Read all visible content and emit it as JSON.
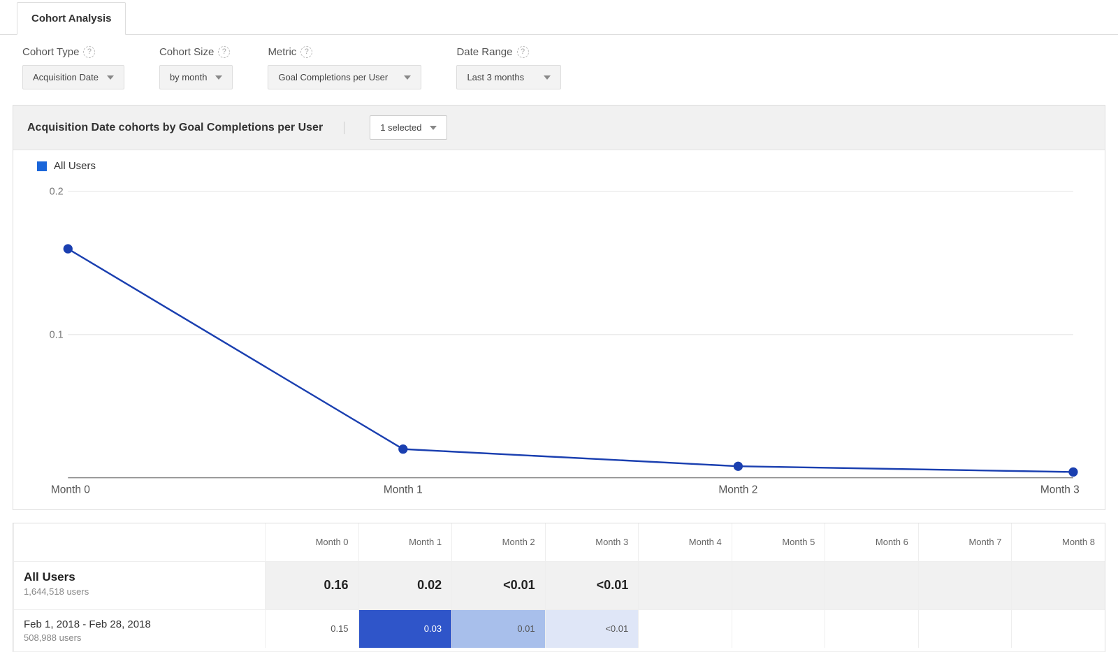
{
  "tab": {
    "label": "Cohort Analysis"
  },
  "filters": {
    "cohortType": {
      "label": "Cohort Type",
      "value": "Acquisition Date"
    },
    "cohortSize": {
      "label": "Cohort Size",
      "value": "by month"
    },
    "metric": {
      "label": "Metric",
      "value": "Goal Completions per User"
    },
    "dateRange": {
      "label": "Date Range",
      "value": "Last 3 months"
    }
  },
  "panel": {
    "title": "Acquisition Date cohorts by Goal Completions per User",
    "selected": "1 selected"
  },
  "legend": {
    "series1": "All Users"
  },
  "chart_data": {
    "type": "line",
    "title": "Acquisition Date cohorts by Goal Completions per User",
    "xlabel": "",
    "ylabel": "",
    "ylim": [
      0,
      0.2
    ],
    "y_ticks": [
      0.1,
      0.2
    ],
    "categories": [
      "Month 0",
      "Month 1",
      "Month 2",
      "Month 3"
    ],
    "series": [
      {
        "name": "All Users",
        "values": [
          0.16,
          0.02,
          0.008,
          0.004
        ]
      }
    ]
  },
  "table": {
    "headers": [
      "Month 0",
      "Month 1",
      "Month 2",
      "Month 3",
      "Month 4",
      "Month 5",
      "Month 6",
      "Month 7",
      "Month 8"
    ],
    "rows": [
      {
        "kind": "summary",
        "label": "All Users",
        "sublabel": "1,644,518 users",
        "cells": [
          "0.16",
          "0.02",
          "<0.01",
          "<0.01",
          "",
          "",
          "",
          "",
          ""
        ]
      },
      {
        "kind": "cohort",
        "label": "Feb 1, 2018 - Feb 28, 2018",
        "sublabel": "508,988 users",
        "cells": [
          "0.15",
          "0.03",
          "0.01",
          "<0.01",
          "",
          "",
          "",
          "",
          ""
        ],
        "heat": [
          "",
          "heat-dark",
          "heat-mid",
          "heat-light",
          "",
          "",
          "",
          "",
          ""
        ]
      }
    ]
  }
}
